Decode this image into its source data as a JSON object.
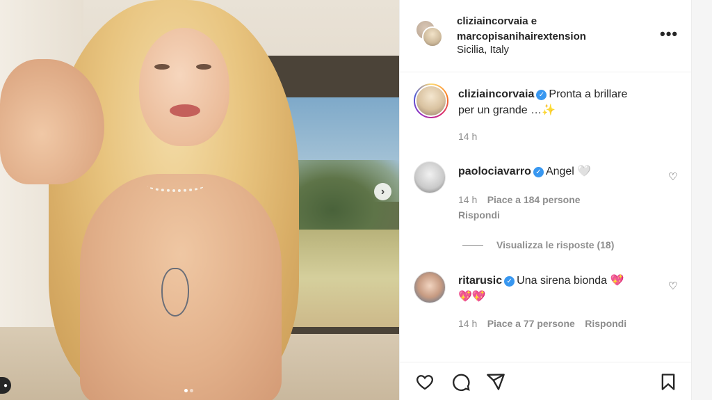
{
  "post": {
    "author_line1": "cliziaincorvaia e",
    "author_line2": "marcopisanihairextension",
    "location": "Sicilia, Italy",
    "more_icon": "ellipsis-icon",
    "carousel": {
      "next_icon": "chevron-right-icon",
      "slides": 2,
      "current": 1
    }
  },
  "caption": {
    "username": "cliziaincorvaia",
    "text": "Pronta a brillare",
    "text2": "per un grande …✨",
    "time": "14 h"
  },
  "comments": [
    {
      "username": "paolociavarro",
      "text": "Angel 🤍",
      "time": "14 h",
      "likes": "Piace a 184 persone",
      "reply": "Rispondi"
    },
    {
      "username": "ritarusic",
      "text": "Una sirena bionda 💖",
      "text2": "💖💖",
      "time": "14 h",
      "likes": "Piace a 77 persone",
      "reply": "Rispondi"
    }
  ],
  "view_replies": "Visualizza le risposte (18)",
  "colors": {
    "verified": "#3897f0",
    "text": "#262626",
    "muted": "#8e8e8e"
  }
}
